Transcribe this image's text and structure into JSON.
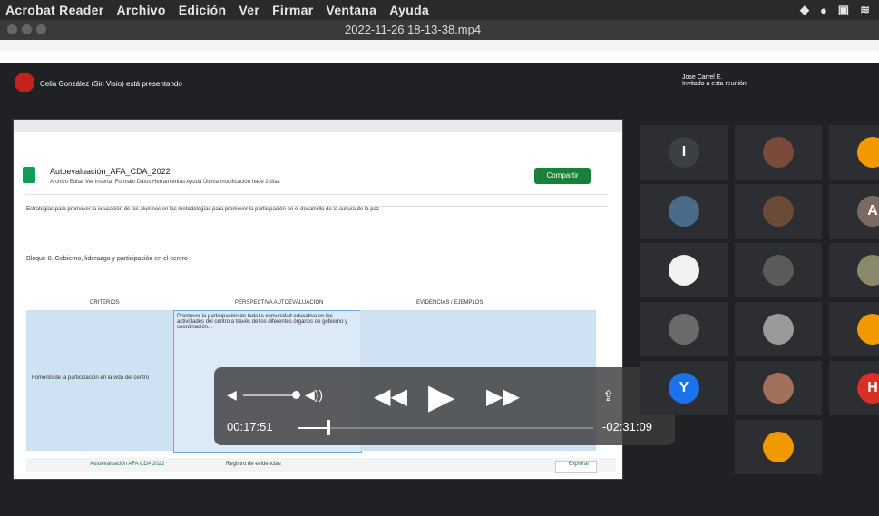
{
  "menubar": {
    "app_name": "Acrobat Reader",
    "items": [
      "Archivo",
      "Edición",
      "Ver",
      "Firmar",
      "Ventana",
      "Ayuda"
    ]
  },
  "player_window": {
    "title": "2022-11-26 18-13-38.mp4"
  },
  "meet": {
    "presenting_text": "Celia González (Sin Visio) está presentando",
    "user_name": "Jose Carrel E.",
    "user_sub": "Invitado a esta reunión"
  },
  "sheet": {
    "title": "Autoevaluación_AFA_CDA_2022",
    "menu": "Archivo  Editar  Ver  Insertar  Formato  Datos  Herramientas  Ayuda  Última modificación hace 2 días",
    "share_label": "Compartir",
    "formula": "Estrategias para promover la educación de los alumnos en las metodologías para promover la participación en el desarrollo de la cultura de la paz",
    "section_header": "Bloque 8. Gobierno, liderazgo y participación en el centro",
    "col_heads": [
      "CRITERIOS",
      "PERSPECTIVA AUTOEVALUACIÓN",
      "EVIDENCIAS / EJEMPLOS"
    ],
    "row_label": "Fomento de la participación en la vida del centro",
    "cell_text": "Promover la participación de toda la comunidad educativa en las actividades del centro a través de los diferentes órganos de gobierno y coordinación...",
    "tabs": [
      "Autoevaluación AFA CDA 2022",
      "Registro de evidencias"
    ],
    "explore_label": "Explorar"
  },
  "player": {
    "current_time": "00:17:51",
    "remaining_time": "-02:31:09",
    "progress": 0.105
  },
  "participants": [
    {
      "initial": "I",
      "color": "#3c4043"
    },
    {
      "initial": "",
      "color": "#7a4a3a"
    },
    {
      "initial": "",
      "color": "#f29900"
    },
    {
      "initial": "",
      "color": "#4a6b8a"
    },
    {
      "initial": "",
      "color": "#6b4a3a"
    },
    {
      "initial": "A",
      "color": "#7a6a60"
    },
    {
      "initial": "",
      "color": "#f1f1f1"
    },
    {
      "initial": "",
      "color": "#5a5a5a"
    },
    {
      "initial": "",
      "color": "#8a8a6a"
    },
    {
      "initial": "",
      "color": "#6a6a6a"
    },
    {
      "initial": "",
      "color": "#9a9a9a"
    },
    {
      "initial": "",
      "color": "#f29900"
    },
    {
      "initial": "Y",
      "color": "#1a73e8"
    },
    {
      "initial": "",
      "color": "#a0705a"
    },
    {
      "initial": "H",
      "color": "#d93025"
    },
    {
      "initial": "",
      "color": "#f29900"
    }
  ]
}
